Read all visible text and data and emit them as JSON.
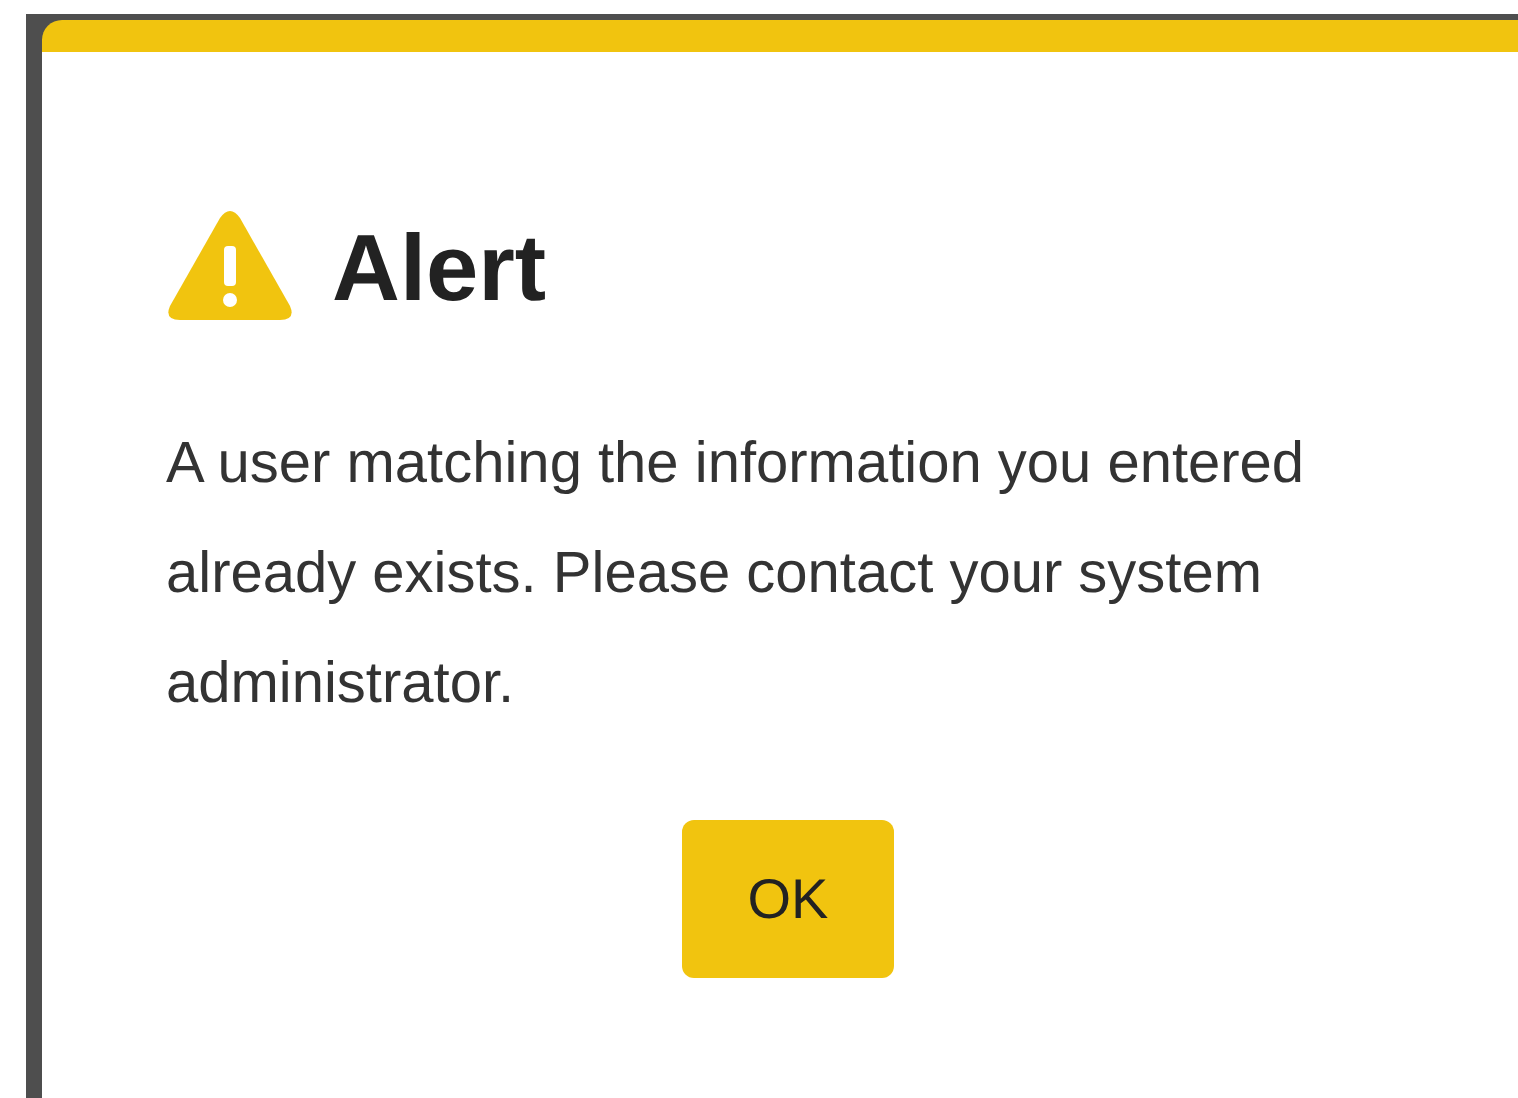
{
  "dialog": {
    "title": "Alert",
    "message": "A user matching the information you entered already exists. Please contact your system administrator.",
    "buttons": [
      "OK"
    ]
  }
}
